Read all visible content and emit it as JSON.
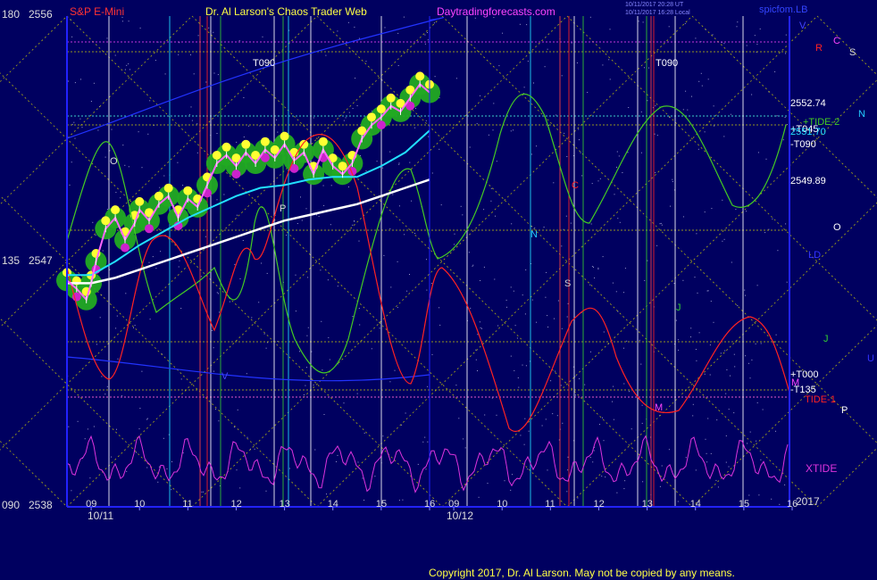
{
  "header": {
    "instrument": "S&P E-Mini",
    "author": "Dr. Al Larson's Chaos Trader Web",
    "site": "Daytradingforecasts.com",
    "timestamp_line1": "10/11/2017 20:28 UT",
    "timestamp_line2": "10/11/2017 16:28 Local",
    "corner_label": "spicfom.LB"
  },
  "footer": {
    "copyright": "Copyright 2017, Dr. Al Larson. May not be copied by any means."
  },
  "colors": {
    "background": "#000060",
    "yellow_grid": "#d8d800",
    "price": "#ff66ff",
    "green_line": "#44cc22",
    "red_line": "#ff2222",
    "cyan_ma": "#22e0ff",
    "white_ma": "#ffffff",
    "xtide": "#dd33dd",
    "axis": "#2222ff"
  },
  "chart_data": {
    "type": "line",
    "title": "S&P E-Mini",
    "xlabel": "",
    "ylabel": "",
    "ylim": [
      2538,
      2556
    ],
    "x_range": [
      8.5,
      16.0
    ],
    "grid": true,
    "left_axis_labels": [
      {
        "angle": "180",
        "price": "2556",
        "value": 2556
      },
      {
        "angle": "135",
        "price": "2547",
        "value": 2547
      },
      {
        "angle": "090",
        "price": "2538",
        "value": 2538
      }
    ],
    "right_price_labels": [
      {
        "text": "2552.74",
        "value": 2552.74
      },
      {
        "text": "2549.89",
        "value": 2549.89
      }
    ],
    "dates": [
      {
        "text": "10/11",
        "day": 0
      },
      {
        "text": "10/12",
        "day": 1
      }
    ],
    "hour_ticks": [
      {
        "day": 0,
        "labels": [
          "09",
          "10",
          "11",
          "12",
          "13",
          "14",
          "15",
          "16"
        ]
      },
      {
        "day": 1,
        "labels": [
          "09",
          "10",
          "11",
          "12",
          "13",
          "14",
          "15",
          "16"
        ]
      }
    ],
    "year": "2017",
    "series": [
      {
        "name": "price",
        "color": "#ff66ff",
        "x": [
          8.5,
          8.7,
          8.9,
          9.0,
          9.1,
          9.3,
          9.5,
          9.7,
          9.9,
          10.0,
          10.2,
          10.4,
          10.6,
          10.8,
          11.0,
          11.2,
          11.4,
          11.6,
          11.8,
          12.0,
          12.2,
          12.4,
          12.6,
          12.8,
          13.0,
          13.2,
          13.4,
          13.6,
          13.8,
          14.0,
          14.2,
          14.4,
          14.6,
          14.8,
          15.0,
          15.2,
          15.4,
          15.6,
          15.8,
          16.0
        ],
        "y": [
          2546.3,
          2546.0,
          2545.6,
          2546.2,
          2547.0,
          2548.2,
          2548.6,
          2547.8,
          2548.4,
          2548.9,
          2548.5,
          2549.1,
          2549.4,
          2548.6,
          2549.3,
          2549.0,
          2549.8,
          2550.6,
          2550.9,
          2550.5,
          2551.0,
          2550.6,
          2551.1,
          2550.8,
          2551.3,
          2550.7,
          2551.0,
          2550.2,
          2551.1,
          2550.5,
          2550.2,
          2550.6,
          2551.5,
          2552.0,
          2552.3,
          2552.7,
          2552.5,
          2553.0,
          2553.5,
          2553.2
        ]
      },
      {
        "name": "cyan-ma",
        "color": "#22e0ff",
        "x": [
          8.5,
          9.0,
          9.5,
          10.0,
          10.5,
          11.0,
          11.5,
          12.0,
          12.5,
          13.0,
          13.5,
          14.0,
          14.5,
          15.0,
          15.5,
          16.0
        ],
        "y": [
          2546.5,
          2546.5,
          2547.0,
          2547.6,
          2548.1,
          2548.6,
          2549.0,
          2549.4,
          2549.7,
          2549.8,
          2550.0,
          2550.1,
          2550.1,
          2550.5,
          2551.0,
          2551.8
        ]
      },
      {
        "name": "white-ma",
        "color": "#ffffff",
        "x": [
          8.5,
          9.0,
          9.5,
          10.0,
          10.5,
          11.0,
          11.5,
          12.0,
          12.5,
          13.0,
          13.5,
          14.0,
          14.5,
          15.0,
          15.5,
          16.0
        ],
        "y": [
          2546.2,
          2546.2,
          2546.4,
          2546.7,
          2547.0,
          2547.3,
          2547.6,
          2547.9,
          2548.2,
          2548.5,
          2548.7,
          2548.9,
          2549.1,
          2549.4,
          2549.7,
          2550.0
        ]
      }
    ],
    "right_labels": [
      {
        "text": "+TIDE-2",
        "color": "#44cc22"
      },
      {
        "text": "+T045",
        "color": "#ffffff"
      },
      {
        "text": "2551.70",
        "color": "#22e0ff"
      },
      {
        "text": "-T090",
        "color": "#ffffff"
      },
      {
        "text": "+T000",
        "color": "#ffffff"
      },
      {
        "text": "-T135",
        "color": "#ffffff"
      },
      {
        "text": "TIDE-1",
        "color": "#ff2222"
      },
      {
        "text": "XTIDE",
        "color": "#dd33dd"
      }
    ],
    "planet_letters": [
      {
        "text": "V",
        "color": "#4444ff"
      },
      {
        "text": "R",
        "color": "#ff2222"
      },
      {
        "text": "C",
        "color": "#ff44ff"
      },
      {
        "text": "S",
        "color": "#dddddd"
      },
      {
        "text": "N",
        "color": "#22ccff"
      },
      {
        "text": "O",
        "color": "#ffffff"
      },
      {
        "text": "LD",
        "color": "#3333ff"
      },
      {
        "text": "J",
        "color": "#33cc33"
      },
      {
        "text": "U",
        "color": "#3333ff"
      },
      {
        "text": "M",
        "color": "#ff44ff"
      },
      {
        "text": "P",
        "color": "#ffffff"
      }
    ],
    "in_chart_labels": [
      {
        "text": "T090",
        "color": "#ffffff"
      },
      {
        "text": "T090",
        "color": "#ffffff"
      },
      {
        "text": "O",
        "color": "#dddddd"
      },
      {
        "text": "P",
        "color": "#dddddd"
      },
      {
        "text": "N",
        "color": "#22ccff"
      },
      {
        "text": "S",
        "color": "#cccccc"
      },
      {
        "text": "C",
        "color": "#ff2222"
      },
      {
        "text": "J",
        "color": "#33cc33"
      },
      {
        "text": "M",
        "color": "#ff44ff"
      },
      {
        "text": "V",
        "color": "#4444ff"
      }
    ]
  }
}
